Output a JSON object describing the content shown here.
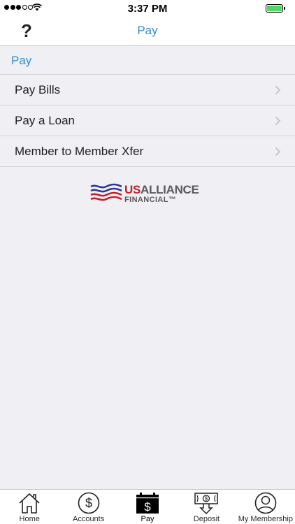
{
  "status_bar": {
    "time": "3:37 PM",
    "signal_bars_filled": 3,
    "signal_bars_total": 5,
    "battery_level": 1.0,
    "battery_color": "#4cd964"
  },
  "nav": {
    "help_icon": "?",
    "title": "Pay"
  },
  "section": {
    "header": "Pay"
  },
  "menu": {
    "items": [
      {
        "label": "Pay Bills",
        "icon": "chevron-right-icon"
      },
      {
        "label": "Pay a Loan",
        "icon": "chevron-right-icon"
      },
      {
        "label": "Member to Member Xfer",
        "icon": "chevron-right-icon"
      }
    ]
  },
  "logo": {
    "us": "US",
    "alliance": "ALLIANCE",
    "financial": "FINANCIAL™"
  },
  "tabs": [
    {
      "label": "Home",
      "icon": "home-icon",
      "active": false
    },
    {
      "label": "Accounts",
      "icon": "dollar-circle-icon",
      "active": false
    },
    {
      "label": "Pay",
      "icon": "pay-calendar-icon",
      "active": true
    },
    {
      "label": "Deposit",
      "icon": "deposit-check-icon",
      "active": false
    },
    {
      "label": "My Membership",
      "icon": "user-circle-icon",
      "active": false
    }
  ],
  "colors": {
    "accent": "#2f8dd0",
    "background": "#efeff4",
    "logo_red": "#c41f2b",
    "logo_blue": "#2b3990",
    "logo_gray": "#5a5a5a"
  }
}
